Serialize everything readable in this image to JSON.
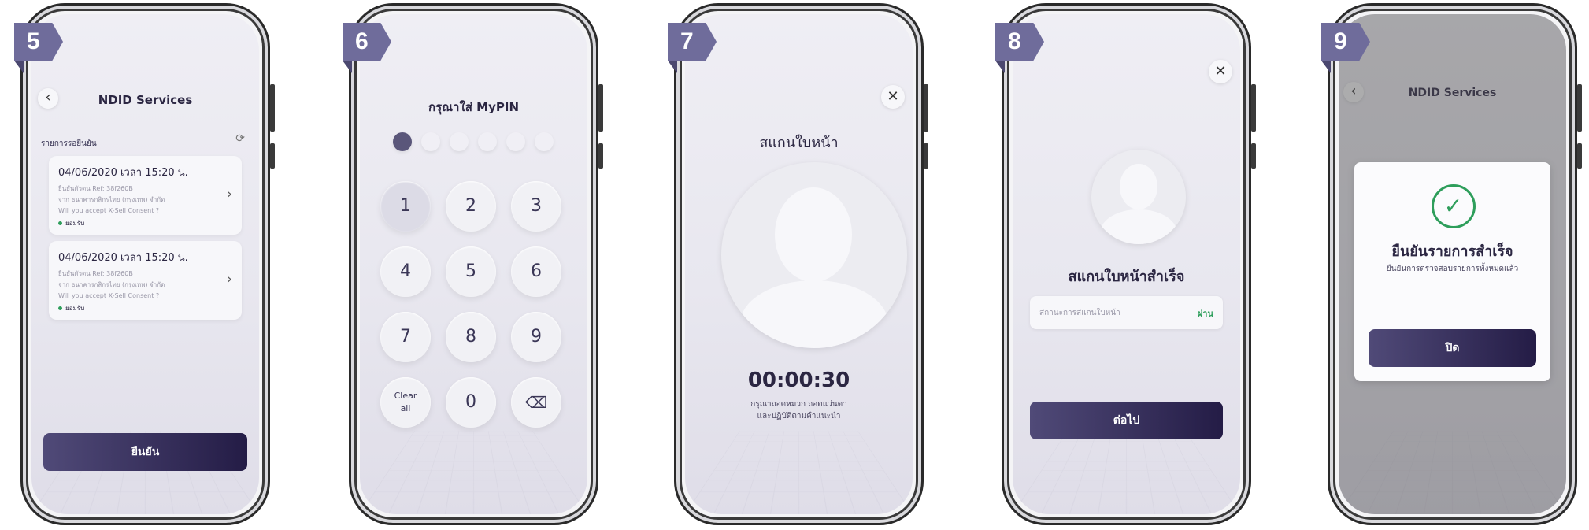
{
  "step5": {
    "badge": "5",
    "title": "NDID Services",
    "section_label": "รายการรอยืนยัน",
    "items": [
      {
        "datetime": "04/06/2020 เวลา 15:20 น.",
        "line1": "ยืนยันตัวตน Ref: 38f260B",
        "line2": "จาก ธนาคารกสิกรไทย (กรุงเทพ) จำกัด",
        "line3": "Will you accept X-Sell Consent ?",
        "status": "ยอมรับ"
      },
      {
        "datetime": "04/06/2020 เวลา 15:20 น.",
        "line1": "ยืนยันตัวตน Ref: 38f260B",
        "line2": "จาก ธนาคารกสิกรไทย (กรุงเทพ) จำกัด",
        "line3": "Will you accept X-Sell Consent ?",
        "status": "ยอมรับ"
      }
    ],
    "confirm_label": "ยืนยัน"
  },
  "step6": {
    "badge": "6",
    "title": "กรุณาใส่ MyPIN",
    "pin_filled": 1,
    "pin_length": 6,
    "keys": [
      "1",
      "2",
      "3",
      "4",
      "5",
      "6",
      "7",
      "8",
      "9"
    ],
    "clear_label": "Clear all",
    "zero": "0",
    "backspace_icon": "backspace-icon"
  },
  "step7": {
    "badge": "7",
    "title": "สแกนใบหน้า",
    "timer": "00:00:30",
    "instruction_1": "กรุณาถอดหมวก ถอดแว่นตา",
    "instruction_2": "และปฏิบัติตามคำแนะนำ"
  },
  "step8": {
    "badge": "8",
    "title": "สแกนใบหน้าสำเร็จ",
    "status_label": "สถานะการสแกนใบหน้า",
    "status_value": "ผ่าน",
    "next_label": "ต่อไป"
  },
  "step9": {
    "badge": "9",
    "title": "NDID Services",
    "dialog_title": "ยืนยันรายการสำเร็จ",
    "dialog_subtitle": "ยืนยันการตรวจสอบรายการทั้งหมดแล้ว",
    "close_label": "ปิด"
  },
  "colors": {
    "accent": "#2b2348",
    "badge": "#6f6c9b",
    "success": "#2e9e5b"
  }
}
